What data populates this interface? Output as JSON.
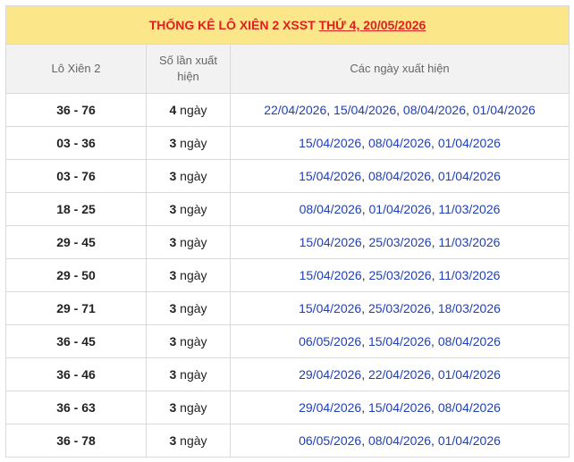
{
  "title": {
    "prefix": "THỐNG KÊ LÔ XIÊN 2 XSST",
    "link": "THỨ 4, 20/05/2026"
  },
  "headers": {
    "pair": "Lô Xiên 2",
    "count": "Số lần xuất hiện",
    "dates": "Các ngày xuất hiện"
  },
  "rows": [
    {
      "pair": "36 - 76",
      "count": "4",
      "unit": "ngày",
      "dates": [
        "22/04/2026",
        "15/04/2026",
        "08/04/2026",
        "01/04/2026"
      ]
    },
    {
      "pair": "03 - 36",
      "count": "3",
      "unit": "ngày",
      "dates": [
        "15/04/2026",
        "08/04/2026",
        "01/04/2026"
      ]
    },
    {
      "pair": "03 - 76",
      "count": "3",
      "unit": "ngày",
      "dates": [
        "15/04/2026",
        "08/04/2026",
        "01/04/2026"
      ]
    },
    {
      "pair": "18 - 25",
      "count": "3",
      "unit": "ngày",
      "dates": [
        "08/04/2026",
        "01/04/2026",
        "11/03/2026"
      ]
    },
    {
      "pair": "29 - 45",
      "count": "3",
      "unit": "ngày",
      "dates": [
        "15/04/2026",
        "25/03/2026",
        "11/03/2026"
      ]
    },
    {
      "pair": "29 - 50",
      "count": "3",
      "unit": "ngày",
      "dates": [
        "15/04/2026",
        "25/03/2026",
        "11/03/2026"
      ]
    },
    {
      "pair": "29 - 71",
      "count": "3",
      "unit": "ngày",
      "dates": [
        "15/04/2026",
        "25/03/2026",
        "18/03/2026"
      ]
    },
    {
      "pair": "36 - 45",
      "count": "3",
      "unit": "ngày",
      "dates": [
        "06/05/2026",
        "15/04/2026",
        "08/04/2026"
      ]
    },
    {
      "pair": "36 - 46",
      "count": "3",
      "unit": "ngày",
      "dates": [
        "29/04/2026",
        "22/04/2026",
        "01/04/2026"
      ]
    },
    {
      "pair": "36 - 63",
      "count": "3",
      "unit": "ngày",
      "dates": [
        "29/04/2026",
        "15/04/2026",
        "08/04/2026"
      ]
    },
    {
      "pair": "36 - 78",
      "count": "3",
      "unit": "ngày",
      "dates": [
        "06/05/2026",
        "08/04/2026",
        "01/04/2026"
      ]
    }
  ]
}
